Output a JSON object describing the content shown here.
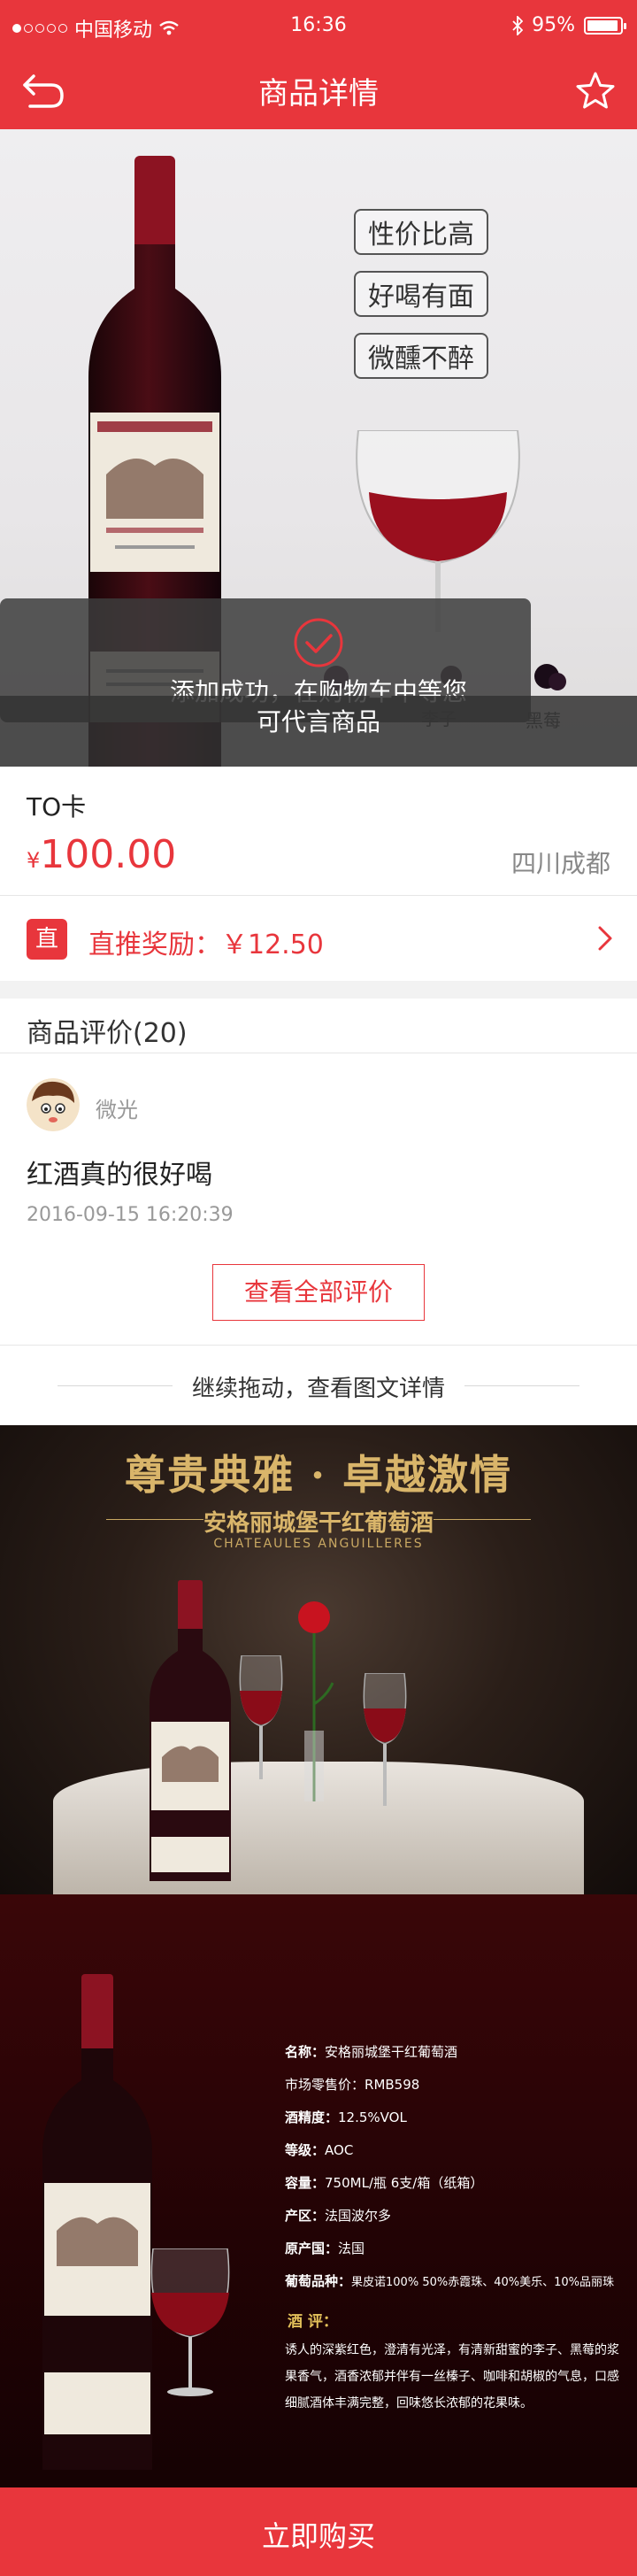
{
  "status_bar": {
    "carrier": "中国移动",
    "time": "16:36",
    "battery": "95%"
  },
  "nav": {
    "title": "商品详情"
  },
  "hero": {
    "tags": [
      "性价比高",
      "好喝有面",
      "微醺不醉"
    ],
    "berry_labels": [
      "李子",
      "黑莓"
    ],
    "toast_line1": "添加成功，在购物车中等您",
    "toast_line2": "可代言商品"
  },
  "product": {
    "name": "TO卡",
    "currency": "¥",
    "price": "100.00",
    "location": "四川成都"
  },
  "reward": {
    "badge": "直",
    "label": "直推奖励：￥12.50"
  },
  "reviews": {
    "header": "商品评价(20)",
    "items": [
      {
        "user": "微光",
        "text": "红酒真的很好喝",
        "date": "2016-09-15 16:20:39"
      }
    ],
    "view_all": "查看全部评价"
  },
  "continue_hint": "继续拖动，查看图文详情",
  "banner1": {
    "headline": "尊贵典雅 · 卓越激情",
    "subtitle": "安格丽城堡干红葡萄酒",
    "latin": "CHATEAULES  ANGUILLERES"
  },
  "banner2": {
    "specs": [
      {
        "k": "名称：",
        "v": "安格丽城堡干红葡萄酒"
      },
      {
        "k": "市场零售价：",
        "v": "RMB598"
      },
      {
        "k": "酒精度：",
        "v": "12.5%VOL"
      },
      {
        "k": "等级：",
        "v": "AOC"
      },
      {
        "k": "容量：",
        "v": "750ML/瓶  6支/箱（纸箱）"
      },
      {
        "k": "产区：",
        "v": "法国波尔多"
      },
      {
        "k": "原产国：",
        "v": "法国"
      },
      {
        "k": "葡萄品种：",
        "v": "果皮诺100% 50%赤霞珠、40%美乐、10%品丽珠"
      }
    ],
    "review_title": "酒    评：",
    "review_body": "诱人的深紫红色，澄清有光泽，有清新甜蜜的李子、黑莓的浆果香气，酒香浓郁并伴有一丝榛子、咖啡和胡椒的气息，口感细腻酒体丰满完整，回味悠长浓郁的花果味。"
  },
  "buy_button": "立即购买",
  "colors": {
    "brand_red": "#e8363c",
    "gold": "#d9b56a"
  }
}
